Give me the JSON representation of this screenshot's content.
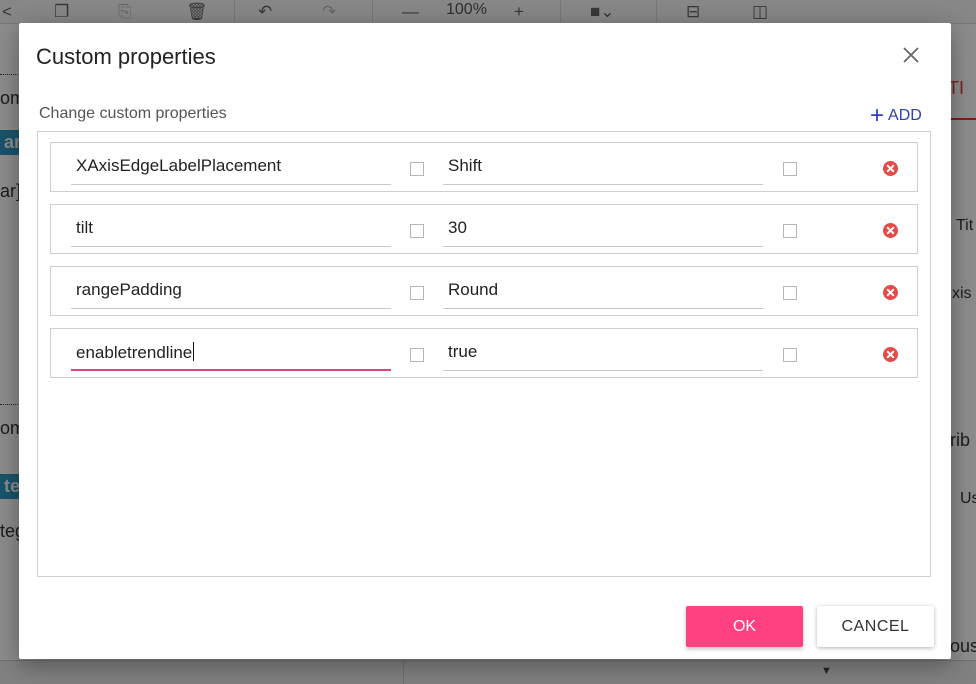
{
  "background": {
    "toolbar": {
      "zoom": "100%"
    },
    "fragments": [
      "om",
      "ar",
      "ar]",
      "om",
      "teg",
      "teg",
      "TI",
      "Tit",
      "xis",
      "trib",
      "Us",
      "ous"
    ]
  },
  "dialog": {
    "title": "Custom properties",
    "subtitle": "Change custom properties",
    "add_label": "ADD",
    "properties": [
      {
        "name": "XAxisEdgeLabelPlacement",
        "value": "Shift"
      },
      {
        "name": "tilt",
        "value": "30"
      },
      {
        "name": "rangePadding",
        "value": "Round"
      },
      {
        "name": "enabletrendline",
        "value": "true"
      }
    ],
    "ok_label": "OK",
    "cancel_label": "CANCEL"
  },
  "colors": {
    "accent": "#ff4081",
    "link": "#2c3fb8",
    "delete": "#e84a4a"
  }
}
